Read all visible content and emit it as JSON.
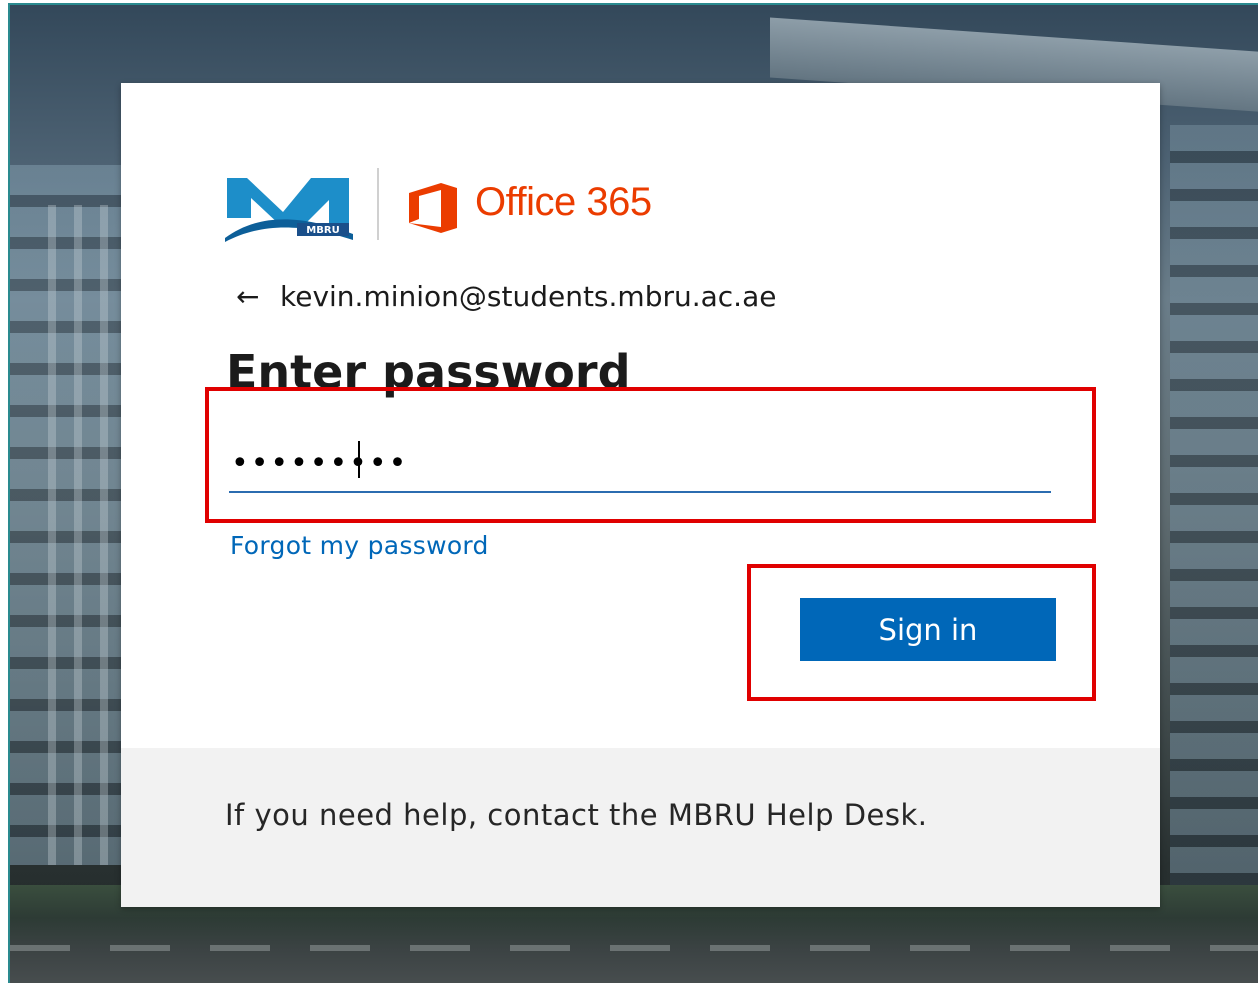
{
  "brand": {
    "org_logo_text": "MBRU",
    "product_name": "Office 365",
    "product_color": "#eb3c00"
  },
  "identity": {
    "back_icon": "arrow-left-icon",
    "back_glyph": "←",
    "email": "kevin.minion@students.mbru.ac.ae"
  },
  "form": {
    "title": "Enter password",
    "password_value": "•••••••••",
    "forgot_link": "Forgot my password",
    "submit_label": "Sign in",
    "accent_color": "#0067b8"
  },
  "footer": {
    "help_text": "If you need help, contact the MBRU Help Desk."
  },
  "annotations": {
    "highlight_color": "#e00000"
  }
}
